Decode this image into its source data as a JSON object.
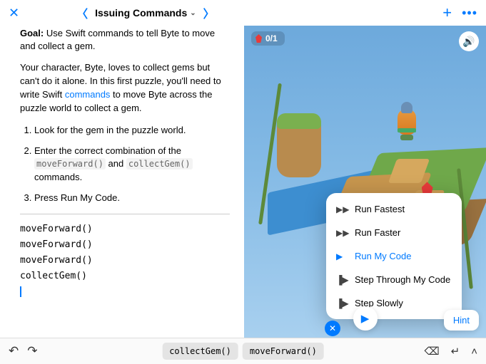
{
  "header": {
    "title": "Issuing Commands"
  },
  "instructions": {
    "goal_label": "Goal:",
    "goal_text": " Use Swift commands to tell Byte to move and collect a gem.",
    "desc_pre": "Your character, Byte, loves to collect gems but can't do it alone. In this first puzzle, you'll need to write Swift ",
    "desc_link": "commands",
    "desc_post": " to move Byte across the puzzle world to collect a gem.",
    "steps": [
      "Look for the gem in the puzzle world.",
      "Enter the correct combination of the ",
      "Press Run My Code."
    ],
    "step2_code1": "moveForward()",
    "step2_mid": " and ",
    "step2_code2": "collectGem()",
    "step2_post": " commands."
  },
  "code_lines": [
    "moveForward()",
    "moveForward()",
    "moveForward()",
    "collectGem()"
  ],
  "world": {
    "gem_count": "0/1"
  },
  "run_menu": {
    "items": [
      {
        "label": "Run Fastest",
        "active": false
      },
      {
        "label": "Run Faster",
        "active": false
      },
      {
        "label": "Run My Code",
        "active": true
      },
      {
        "label": "Step Through My Code",
        "active": false
      },
      {
        "label": "Step Slowly",
        "active": false
      }
    ]
  },
  "hint_label": "Hint",
  "suggestions": [
    "collectGem()",
    "moveForward()"
  ]
}
